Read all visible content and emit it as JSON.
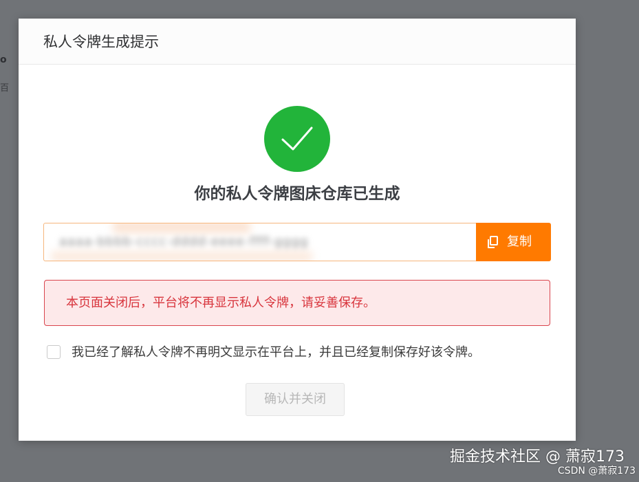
{
  "background": {
    "glyph_1": "o",
    "glyph_2": "百"
  },
  "modal": {
    "title": "私人令牌生成提示",
    "success_title": "你的私人令牌图床仓库已生成",
    "token": {
      "value": "aaaa-bbbb-cccc-dddd-eeee-ffff-gggg",
      "is_blurred": true
    },
    "copy_button": {
      "label": "复制",
      "icon": "copy-icon"
    },
    "warning": {
      "text": "本页面关闭后，平台将不再显示私人令牌，请妥善保存。"
    },
    "acknowledge": {
      "checked": false,
      "label": "我已经了解私人令牌不再明文显示在平台上，并且已经复制保存好该令牌。"
    },
    "confirm_button": {
      "label": "确认并关闭",
      "disabled": true
    }
  },
  "watermark": {
    "main": "掘金技术社区 @ 萧寂173",
    "sub": "CSDN @萧寂173"
  },
  "colors": {
    "overlay": "#707377",
    "success": "#22b43a",
    "accent": "#ff7a00",
    "warning_border": "#d9434c",
    "warning_bg": "#fde9ea",
    "warning_text": "#d8343c"
  }
}
